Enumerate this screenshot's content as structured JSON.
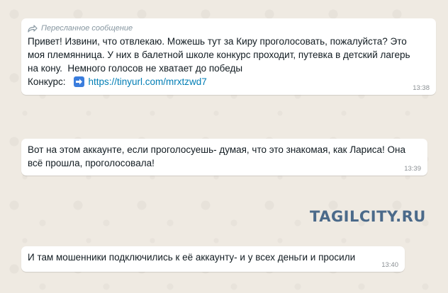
{
  "messages": [
    {
      "forwarded_label": "Пересланное сообщение",
      "text": "Привет! Извини, что отвлекаю. Можешь тут за Киру проголосовать, пожалуйста? Это\nмоя племянница. У них в балетной школе конкурс проходит, путевка в детский лагерь\nна кону.  Немного голосов не хватает до победы",
      "link_label": "Конкурс:",
      "link_icon": "right-arrow-emoji-icon",
      "link_text": "https://tinyurl.com/mrxtzwd7",
      "time": "13:38"
    },
    {
      "text": "Вот на этом аккаунте, если проголосуешь- думая, что это знакомая, как Лариса! Она\nвсё прошла, проголосовала!",
      "time": "13:39"
    },
    {
      "text": "И там мошенники подключились к её аккаунту- и у всех деньги и просили",
      "time": "13:40"
    }
  ],
  "watermark": "TAGILCITY.RU",
  "colors": {
    "chat_background": "#efeae2",
    "bubble": "#ffffff",
    "link": "#027eb5",
    "watermark": "#4b6a8a"
  }
}
